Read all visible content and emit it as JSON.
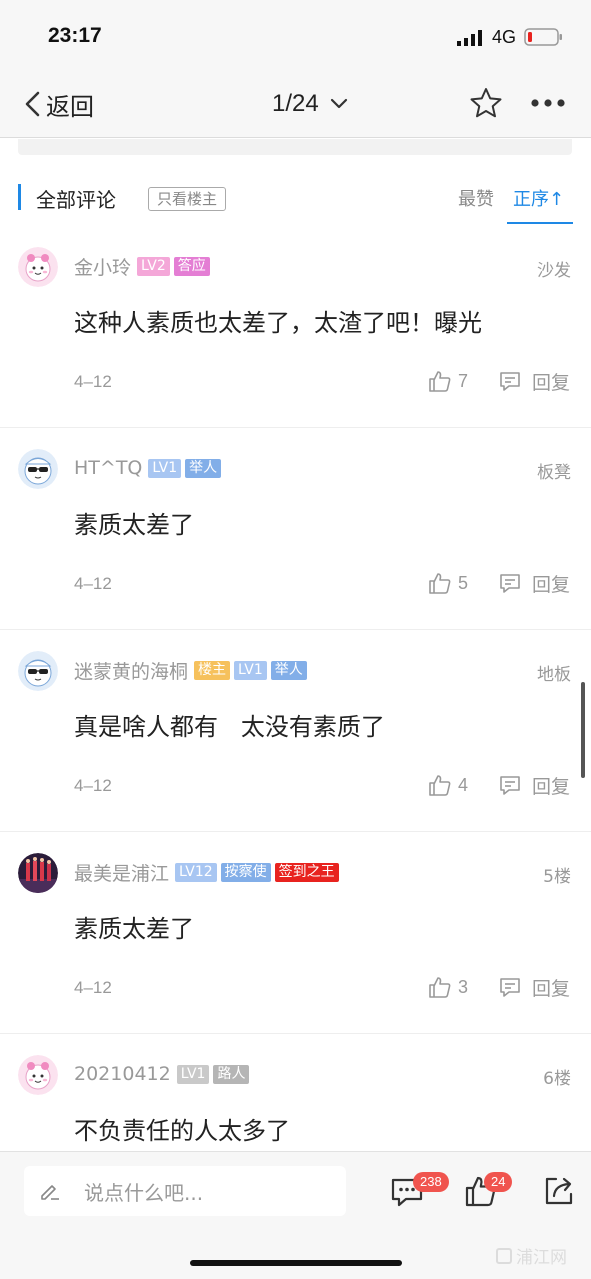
{
  "status_bar": {
    "time": "23:17",
    "network": "4G"
  },
  "nav": {
    "back_label": "返回",
    "page_indicator": "1/24"
  },
  "comment_header": {
    "title": "全部评论",
    "only_owner_label": "只看楼主",
    "sort_hot_label": "最赞",
    "sort_order_label": "正序↑"
  },
  "comments": [
    {
      "name": "金小玲",
      "tags": [
        {
          "text": "LV2",
          "color": "#f4a7d8"
        },
        {
          "text": "答应",
          "color": "#e47ed4"
        }
      ],
      "floor": "沙发",
      "content": "这种人素质也太差了，太渣了吧！曝光",
      "date": "4–12",
      "likes": "7",
      "reply_label": "回复",
      "avatar": "girl"
    },
    {
      "name": "HT^TQ",
      "tags": [
        {
          "text": "LV1",
          "color": "#a8c6f2"
        },
        {
          "text": "举人",
          "color": "#82aee8"
        }
      ],
      "floor": "板凳",
      "content": "素质太差了",
      "date": "4–12",
      "likes": "5",
      "reply_label": "回复",
      "avatar": "cool"
    },
    {
      "name": "迷蒙黄的海桐",
      "tags": [
        {
          "text": "楼主",
          "color": "#f6c15c"
        },
        {
          "text": "LV1",
          "color": "#a8c6f2"
        },
        {
          "text": "举人",
          "color": "#82aee8"
        }
      ],
      "floor": "地板",
      "content": "真是啥人都有   太没有素质了",
      "date": "4–12",
      "likes": "4",
      "reply_label": "回复",
      "avatar": "cool"
    },
    {
      "name": "最美是浦江",
      "tags": [
        {
          "text": "LV12",
          "color": "#a8c6f2"
        },
        {
          "text": "按察使",
          "color": "#82aee8"
        },
        {
          "text": "签到之王",
          "color": "#e8231f"
        }
      ],
      "floor": "5楼",
      "content": "素质太差了",
      "date": "4–12",
      "likes": "3",
      "reply_label": "回复",
      "avatar": "photo"
    },
    {
      "name": "20210412",
      "tags": [
        {
          "text": "LV1",
          "color": "#c9c9c9"
        },
        {
          "text": "路人",
          "color": "#b5b5b5"
        }
      ],
      "floor": "6楼",
      "content": "不负责任的人太多了",
      "date": "",
      "likes": "",
      "reply_label": "",
      "avatar": "girl"
    }
  ],
  "bottom_bar": {
    "input_placeholder": "说点什么吧...",
    "comment_count": "238",
    "like_count": "24",
    "watermark": "浦江网"
  },
  "icons": [
    "signal-icon",
    "battery-icon",
    "back-chevron-icon",
    "dropdown-chevron-icon",
    "star-icon",
    "more-icon",
    "thumb-up-icon",
    "reply-icon",
    "pencil-icon",
    "comment-icon",
    "share-icon"
  ]
}
